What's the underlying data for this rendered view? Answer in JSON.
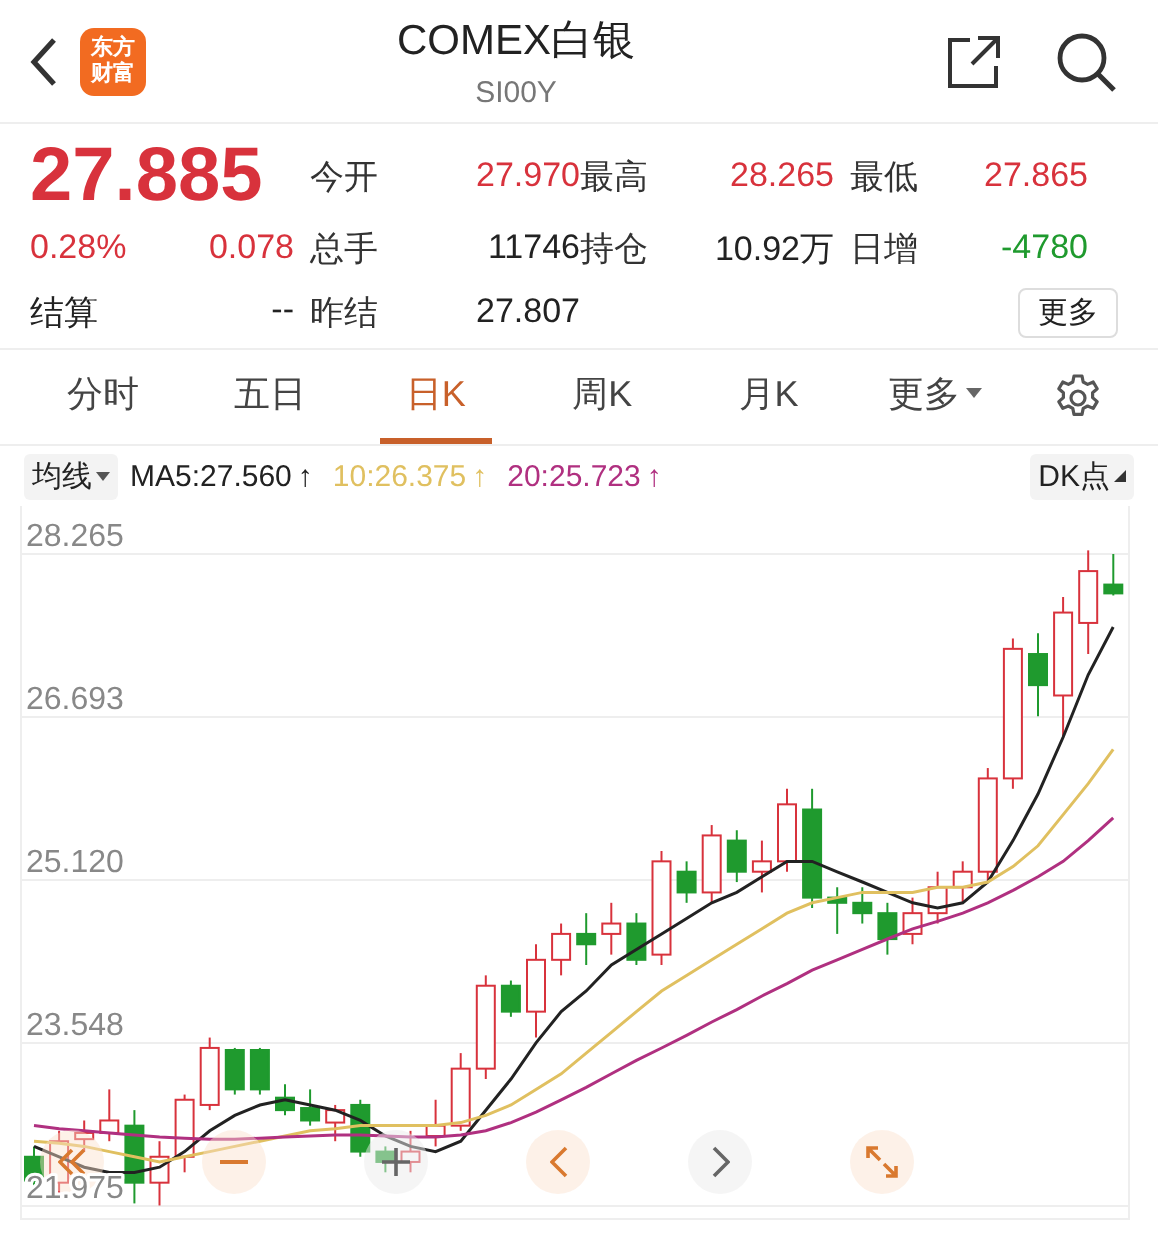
{
  "header": {
    "logo": [
      "东方",
      "财富"
    ],
    "title": "COMEX白银",
    "code": "SI00Y"
  },
  "quote": {
    "price": "27.885",
    "change_pct": "0.28%",
    "change": "0.078",
    "settle_label": "结算",
    "settle_value": "--"
  },
  "stats": [
    {
      "label": "今开",
      "value": "27.970",
      "color": "#d8323c"
    },
    {
      "label": "最高",
      "value": "28.265",
      "color": "#d8323c"
    },
    {
      "label": "最低",
      "value": "27.865",
      "color": "#d8323c"
    },
    {
      "label": "总手",
      "value": "11746",
      "color": "#222222"
    },
    {
      "label": "持仓",
      "value": "10.92万",
      "color": "#222222"
    },
    {
      "label": "日增",
      "value": "-4780",
      "color": "#1f9a2e"
    },
    {
      "label": "昨结",
      "value": "27.807",
      "color": "#222222"
    }
  ],
  "more_button": "更多",
  "tabs": [
    {
      "label": "分时",
      "selected": false
    },
    {
      "label": "五日",
      "selected": false
    },
    {
      "label": "日K",
      "selected": true
    },
    {
      "label": "周K",
      "selected": false
    },
    {
      "label": "月K",
      "selected": false
    },
    {
      "label": "更多",
      "selected": false,
      "dropdown": true
    }
  ],
  "ma_bar": {
    "selector": "均线",
    "arrows": [
      "↑",
      "↑",
      "↑"
    ],
    "dk_button": "DK点"
  },
  "chart_data": {
    "type": "candlestick",
    "ylim": [
      21.975,
      28.265
    ],
    "yticks": [
      {
        "value": 28.265,
        "label": "28.265"
      },
      {
        "value": 26.693,
        "label": "26.693"
      },
      {
        "value": 25.12,
        "label": "25.120"
      },
      {
        "value": 23.548,
        "label": "23.548"
      },
      {
        "value": 21.975,
        "label": "21.975"
      }
    ],
    "ohlc": [
      [
        22.45,
        22.55,
        22.15,
        22.22
      ],
      [
        22.2,
        22.7,
        22.1,
        22.6
      ],
      [
        22.62,
        22.8,
        22.5,
        22.68
      ],
      [
        22.68,
        23.1,
        22.6,
        22.8
      ],
      [
        22.75,
        22.9,
        22.0,
        22.2
      ],
      [
        22.2,
        22.6,
        21.98,
        22.45
      ],
      [
        22.45,
        23.05,
        22.3,
        23.0
      ],
      [
        22.95,
        23.6,
        22.9,
        23.5
      ],
      [
        23.48,
        23.5,
        23.05,
        23.1
      ],
      [
        23.48,
        23.5,
        23.05,
        23.1
      ],
      [
        23.02,
        23.15,
        22.85,
        22.9
      ],
      [
        22.92,
        23.1,
        22.75,
        22.8
      ],
      [
        22.78,
        22.95,
        22.6,
        22.9
      ],
      [
        22.95,
        23.0,
        22.45,
        22.5
      ],
      [
        22.5,
        22.55,
        22.3,
        22.4
      ],
      [
        22.4,
        22.7,
        22.3,
        22.5
      ],
      [
        22.65,
        23.0,
        22.55,
        22.75
      ],
      [
        22.75,
        23.45,
        22.7,
        23.3
      ],
      [
        23.3,
        24.2,
        23.2,
        24.1
      ],
      [
        24.1,
        24.15,
        23.8,
        23.85
      ],
      [
        23.85,
        24.5,
        23.6,
        24.35
      ],
      [
        24.35,
        24.7,
        24.2,
        24.6
      ],
      [
        24.6,
        24.8,
        24.3,
        24.5
      ],
      [
        24.6,
        24.9,
        24.4,
        24.7
      ],
      [
        24.7,
        24.8,
        24.3,
        24.35
      ],
      [
        24.4,
        25.4,
        24.3,
        25.3
      ],
      [
        25.2,
        25.3,
        24.9,
        25.0
      ],
      [
        25.0,
        25.65,
        24.9,
        25.55
      ],
      [
        25.5,
        25.6,
        25.1,
        25.2
      ],
      [
        25.2,
        25.5,
        25.0,
        25.3
      ],
      [
        25.3,
        26.0,
        25.2,
        25.85
      ],
      [
        25.8,
        26.0,
        24.85,
        24.95
      ],
      [
        24.95,
        25.05,
        24.6,
        24.9
      ],
      [
        24.9,
        25.05,
        24.7,
        24.8
      ],
      [
        24.8,
        24.9,
        24.4,
        24.55
      ],
      [
        24.6,
        24.95,
        24.5,
        24.8
      ],
      [
        24.8,
        25.2,
        24.7,
        25.05
      ],
      [
        25.05,
        25.3,
        24.9,
        25.2
      ],
      [
        25.2,
        26.2,
        25.1,
        26.1
      ],
      [
        26.1,
        27.45,
        26.0,
        27.35
      ],
      [
        27.3,
        27.5,
        26.7,
        27.0
      ],
      [
        26.9,
        27.85,
        26.5,
        27.7
      ],
      [
        27.6,
        28.3,
        27.3,
        28.1
      ],
      [
        27.97,
        28.265,
        27.865,
        27.885
      ]
    ],
    "series": [
      {
        "name": "MA5:27.560",
        "type": "line",
        "color": "#222222",
        "values": [
          22.55,
          22.45,
          22.35,
          22.3,
          22.3,
          22.35,
          22.5,
          22.7,
          22.85,
          22.95,
          23.0,
          22.95,
          22.9,
          22.8,
          22.65,
          22.55,
          22.5,
          22.6,
          22.9,
          23.2,
          23.55,
          23.85,
          24.05,
          24.3,
          24.45,
          24.6,
          24.75,
          24.9,
          25.0,
          25.15,
          25.3,
          25.3,
          25.2,
          25.1,
          25.0,
          24.9,
          24.85,
          24.9,
          25.1,
          25.5,
          25.95,
          26.5,
          27.1,
          27.56
        ]
      },
      {
        "name": "10:26.375",
        "type": "line",
        "color": "#e0c060",
        "values": [
          22.6,
          22.58,
          22.55,
          22.5,
          22.45,
          22.4,
          22.45,
          22.5,
          22.55,
          22.6,
          22.65,
          22.7,
          22.72,
          22.75,
          22.75,
          22.75,
          22.75,
          22.78,
          22.85,
          22.95,
          23.1,
          23.25,
          23.45,
          23.65,
          23.85,
          24.05,
          24.2,
          24.35,
          24.5,
          24.65,
          24.8,
          24.9,
          24.95,
          25.0,
          25.0,
          25.0,
          25.05,
          25.05,
          25.1,
          25.25,
          25.45,
          25.75,
          26.05,
          26.38
        ]
      },
      {
        "name": "20:25.723",
        "type": "line",
        "color": "#b03080",
        "values": [
          22.75,
          22.72,
          22.7,
          22.68,
          22.66,
          22.64,
          22.63,
          22.62,
          22.62,
          22.63,
          22.64,
          22.65,
          22.66,
          22.66,
          22.65,
          22.64,
          22.64,
          22.66,
          22.7,
          22.78,
          22.88,
          23.0,
          23.12,
          23.25,
          23.38,
          23.5,
          23.62,
          23.75,
          23.87,
          24.0,
          24.12,
          24.25,
          24.35,
          24.45,
          24.55,
          24.65,
          24.72,
          24.8,
          24.9,
          25.02,
          25.15,
          25.3,
          25.5,
          25.72
        ]
      }
    ],
    "grid": true
  },
  "controls": [
    {
      "kind": "rewind",
      "active": true
    },
    {
      "kind": "zoom_out",
      "active": true
    },
    {
      "kind": "zoom_in",
      "active": false
    },
    {
      "kind": "prev",
      "active": true
    },
    {
      "kind": "next",
      "active": false
    },
    {
      "kind": "expand",
      "active": true
    }
  ]
}
